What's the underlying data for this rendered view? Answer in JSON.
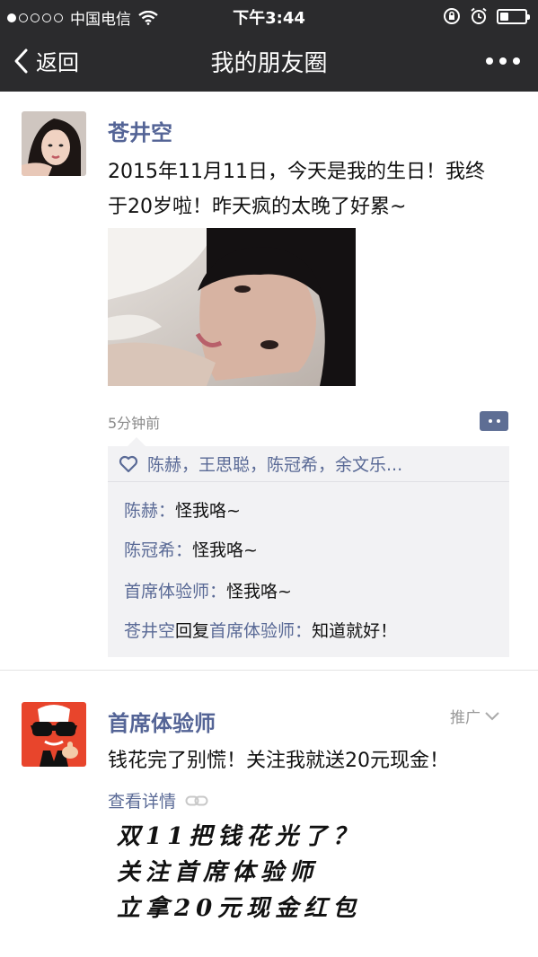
{
  "status_bar": {
    "carrier": "中国电信",
    "time": "下午3:44",
    "signal_filled": 1,
    "signal_total": 5,
    "battery_level": 0.35
  },
  "nav": {
    "back_label": "返回",
    "title": "我的朋友圈",
    "more_icon": "more-dots-icon"
  },
  "post": {
    "author": "苍井空",
    "text_line1": "2015年11月11日，今天是我的生日！我终",
    "text_line2": "于20岁啦！昨天疯的太晚了好累~",
    "time": "5分钟前",
    "likes": "陈赫，王思聪，陈冠希，余文乐...",
    "comments": [
      {
        "name": "陈赫",
        "sep": "：",
        "text": "怪我咯~"
      },
      {
        "name": "陈冠希",
        "sep": "：",
        "text": "怪我咯~"
      },
      {
        "name": "首席体验师",
        "sep": "：",
        "text": "怪我咯~"
      },
      {
        "name": "苍井空",
        "reply_word": "回复",
        "reply_to": "首席体验师",
        "sep": "：",
        "text": "知道就好！"
      }
    ]
  },
  "ad": {
    "author": "首席体验师",
    "tag": "推广",
    "text": "钱花完了别慌！关注我就送20元现金！",
    "detail_link": "查看详情",
    "image_lines": [
      "双11把钱花光了？",
      "关注首席体验师",
      "立拿20元现金红包"
    ]
  },
  "colors": {
    "bar_bg": "#2b2b2d",
    "name_blue": "#546496",
    "panel_bg": "#f2f2f4"
  }
}
